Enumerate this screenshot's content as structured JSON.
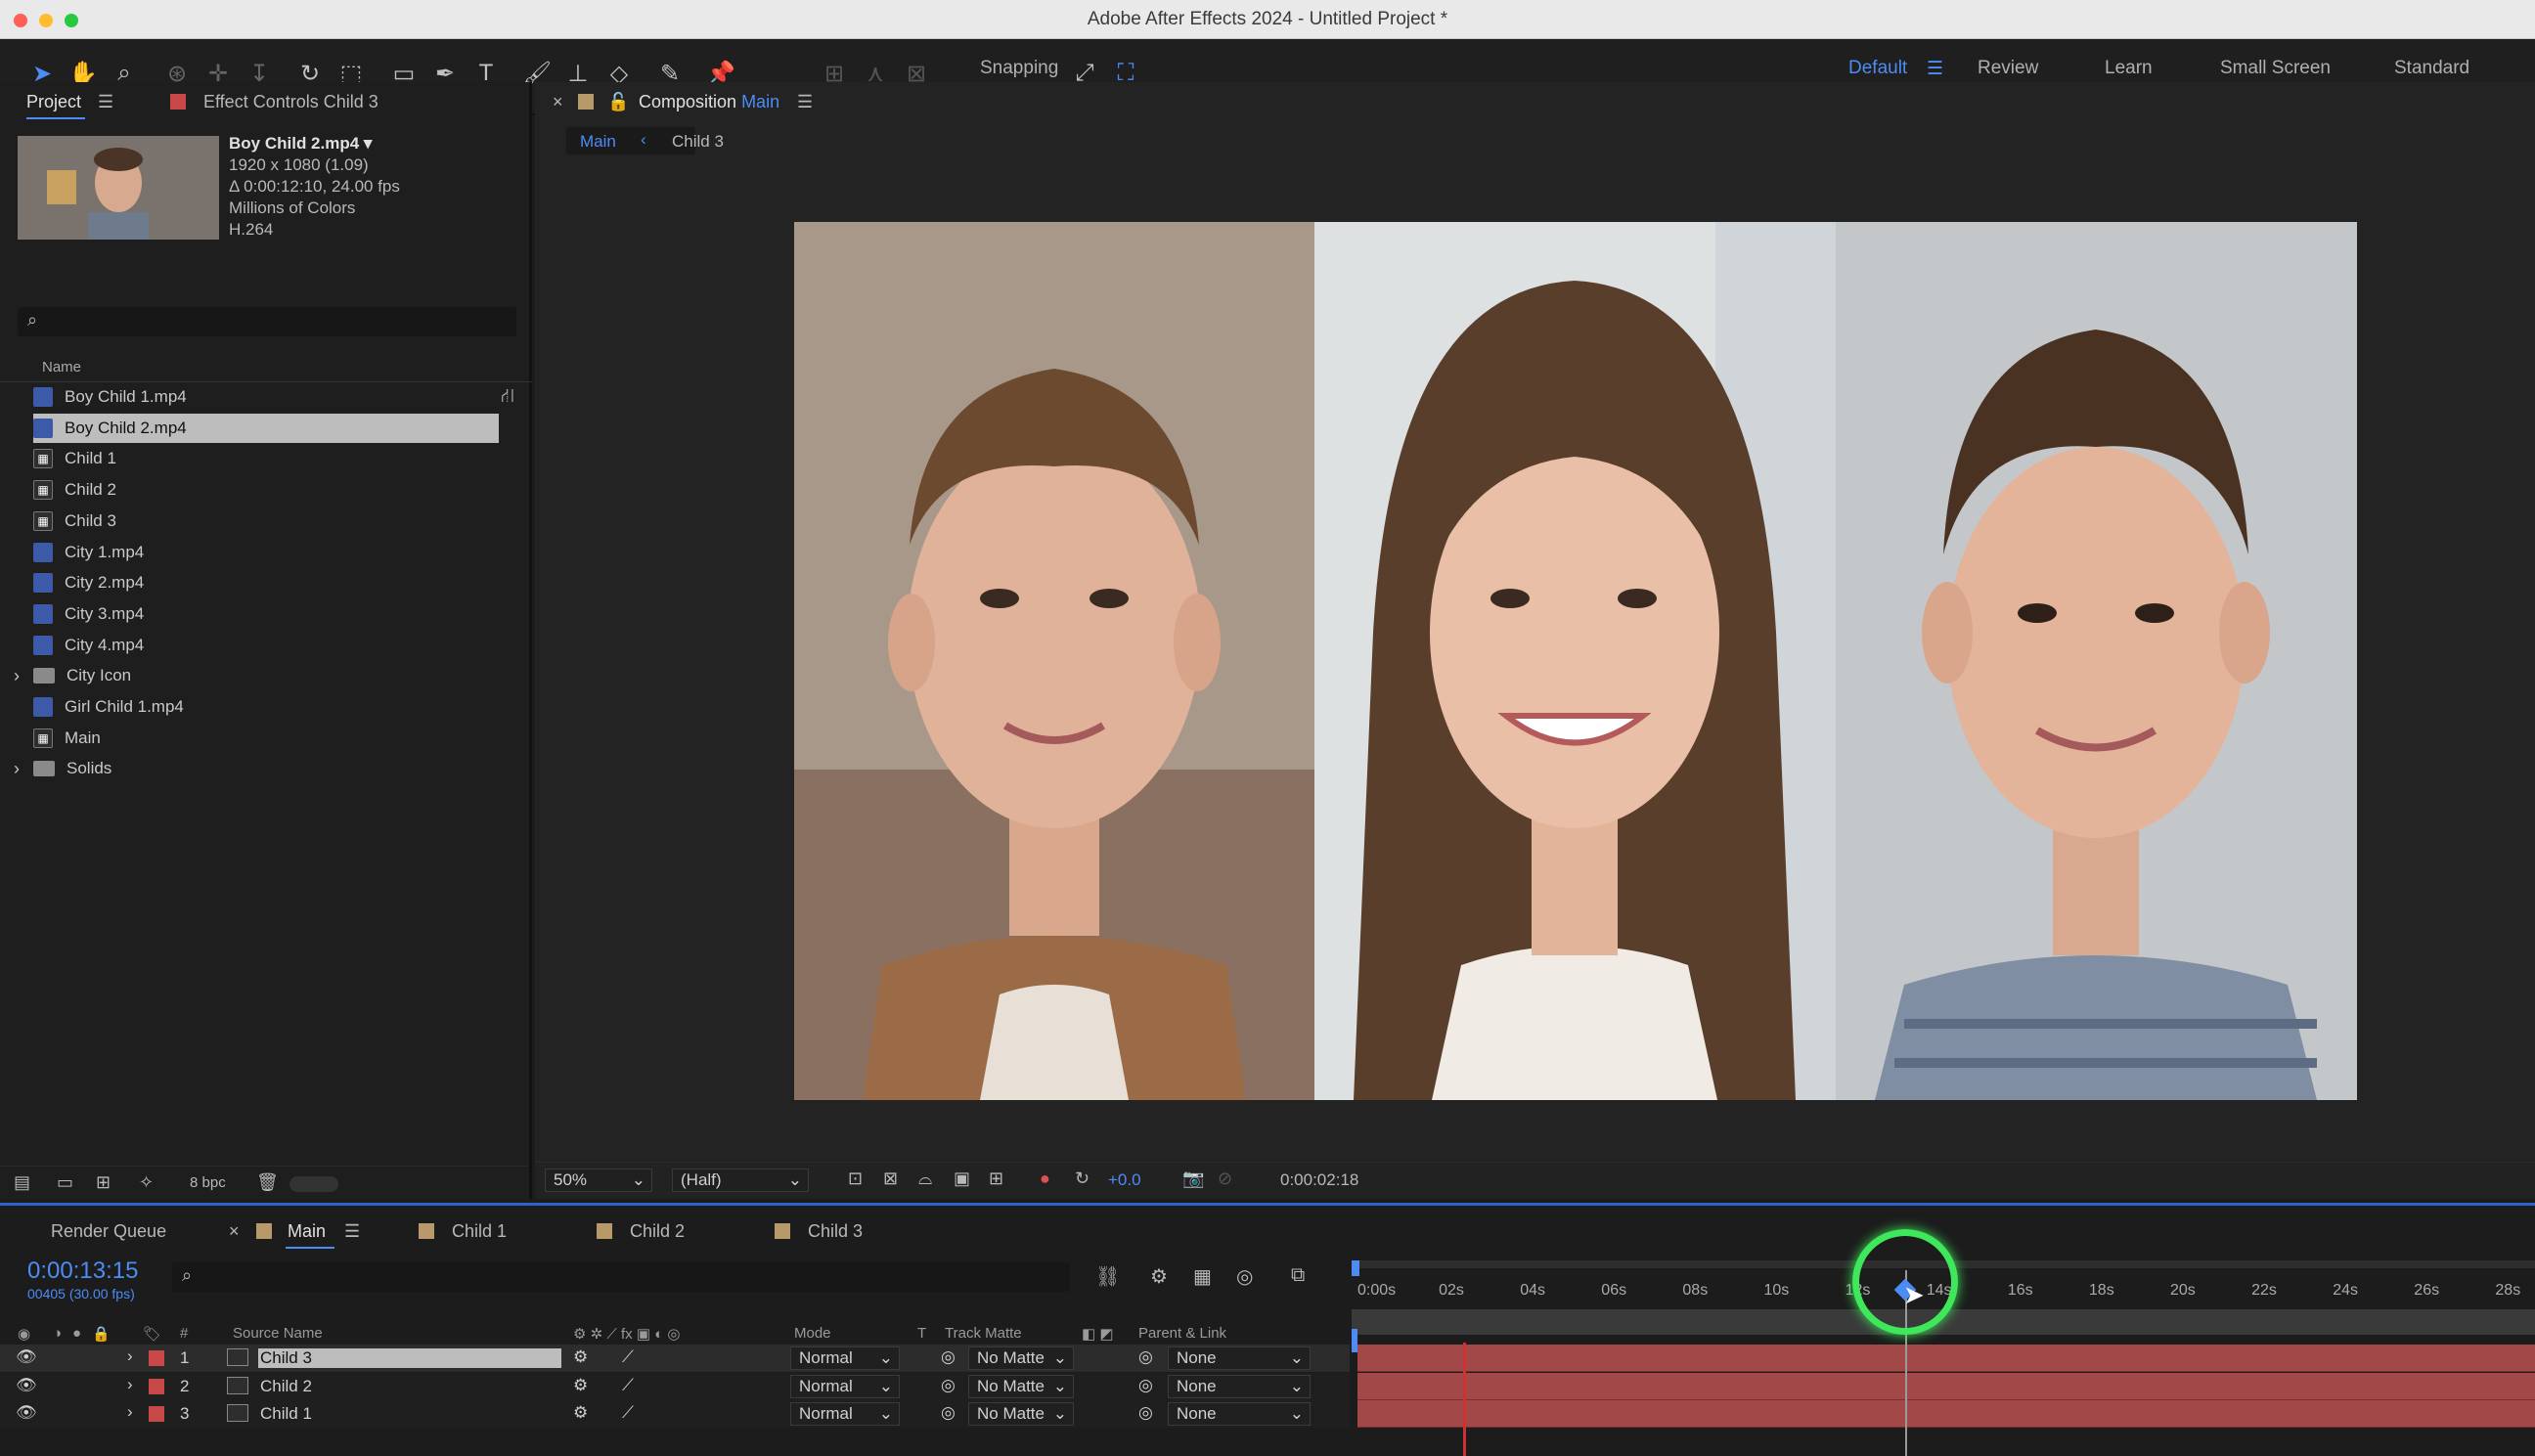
{
  "app": {
    "title": "Adobe After Effects 2024 - Untitled Project *"
  },
  "toolbar": {
    "snapping": "Snapping",
    "workspaces": [
      "Default",
      "Review",
      "Learn",
      "Small Screen",
      "Standard"
    ],
    "active_workspace": "Default"
  },
  "project": {
    "tab_project": "Project",
    "tab_effect": "Effect Controls Child 3",
    "selected": {
      "name": "Boy Child 2.mp4 ▾",
      "resolution": "1920 x 1080 (1.09)",
      "duration": "Δ 0:00:12:10, 24.00 fps",
      "colors": "Millions of Colors",
      "codec": "H.264"
    },
    "col_name": "Name",
    "items": [
      {
        "name": "Boy Child 1.mp4",
        "type": "mp4"
      },
      {
        "name": "Boy Child 2.mp4",
        "type": "mp4",
        "selected": true
      },
      {
        "name": "Child 1",
        "type": "comp"
      },
      {
        "name": "Child 2",
        "type": "comp"
      },
      {
        "name": "Child 3",
        "type": "comp"
      },
      {
        "name": "City 1.mp4",
        "type": "mp4"
      },
      {
        "name": "City 2.mp4",
        "type": "mp4"
      },
      {
        "name": "City 3.mp4",
        "type": "mp4"
      },
      {
        "name": "City 4.mp4",
        "type": "mp4"
      },
      {
        "name": "City Icon",
        "type": "folder"
      },
      {
        "name": "Girl Child 1.mp4",
        "type": "mp4"
      },
      {
        "name": "Main",
        "type": "comp"
      },
      {
        "name": "Solids",
        "type": "folder"
      }
    ],
    "bpc": "8 bpc"
  },
  "composition": {
    "tab_label": "Composition",
    "tab_name": "Main",
    "crumb_main": "Main",
    "crumb_child": "Child 3",
    "zoom": "50%",
    "resolution": "(Half)",
    "exposure": "+0.0",
    "timecode": "0:00:02:18"
  },
  "timeline": {
    "render_queue": "Render Queue",
    "tabs": [
      "Main",
      "Child 1",
      "Child 2",
      "Child 3"
    ],
    "current_time": "0:00:13:15",
    "frame_info": "00405 (30.00 fps)",
    "cols": {
      "num": "#",
      "source": "Source Name",
      "mode": "Mode",
      "t": "T",
      "matte": "Track Matte",
      "parent": "Parent & Link"
    },
    "ticks": [
      "0:00s",
      "02s",
      "04s",
      "06s",
      "08s",
      "10s",
      "12s",
      "14s",
      "16s",
      "18s",
      "20s",
      "22s",
      "24s",
      "26s",
      "28s"
    ],
    "layers": [
      {
        "num": "1",
        "name": "Child 3",
        "mode": "Normal",
        "matte": "No Matte",
        "parent": "None"
      },
      {
        "num": "2",
        "name": "Child 2",
        "mode": "Normal",
        "matte": "No Matte",
        "parent": "None"
      },
      {
        "num": "3",
        "name": "Child 1",
        "mode": "Normal",
        "matte": "No Matte",
        "parent": "None"
      }
    ]
  },
  "colors": {
    "accent": "#2d63c8",
    "layer_label": "#c84848",
    "track": "#a34848",
    "cti_highlight": "#3ee85a"
  }
}
